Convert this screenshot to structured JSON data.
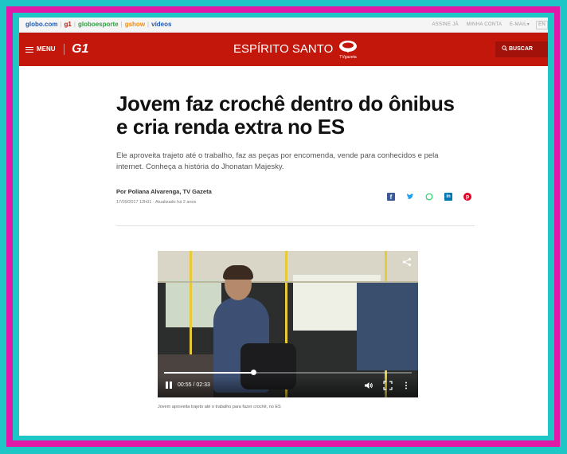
{
  "globobar": {
    "links": [
      "globo.com",
      "g1",
      "globoesporte",
      "gshow",
      "vídeos"
    ],
    "right_links": [
      "ASSINE JÁ",
      "MINHA CONTA",
      "E-MAIL▾"
    ],
    "lang": "EN"
  },
  "header": {
    "menu_label": "MENU",
    "logo": "G1",
    "region": "ESPÍRITO SANTO",
    "affiliate": "TVgazeta",
    "search_label": "BUSCAR",
    "brand_color": "#c4170c"
  },
  "article": {
    "headline": "Jovem faz crochê dentro do ônibus e cria renda extra no ES",
    "subtitle": "Ele aproveita trajeto até o trabalho, faz as peças por encomenda, vende para conhecidos e pela internet. Conheça a história do Jhonatan Majesky.",
    "author": "Por Poliana Alvarenga, TV Gazeta",
    "date": "17/09/2017 12h01 · Atualizado há 2 anos",
    "share_icons": [
      "facebook-icon",
      "twitter-icon",
      "whatsapp-icon",
      "linkedin-icon",
      "pinterest-icon"
    ]
  },
  "video": {
    "time": "00:55 / 02:33",
    "progress": 0.36,
    "caption": "Jovem aproveita trajeto até o trabalho para fazer crochê, no ES"
  }
}
